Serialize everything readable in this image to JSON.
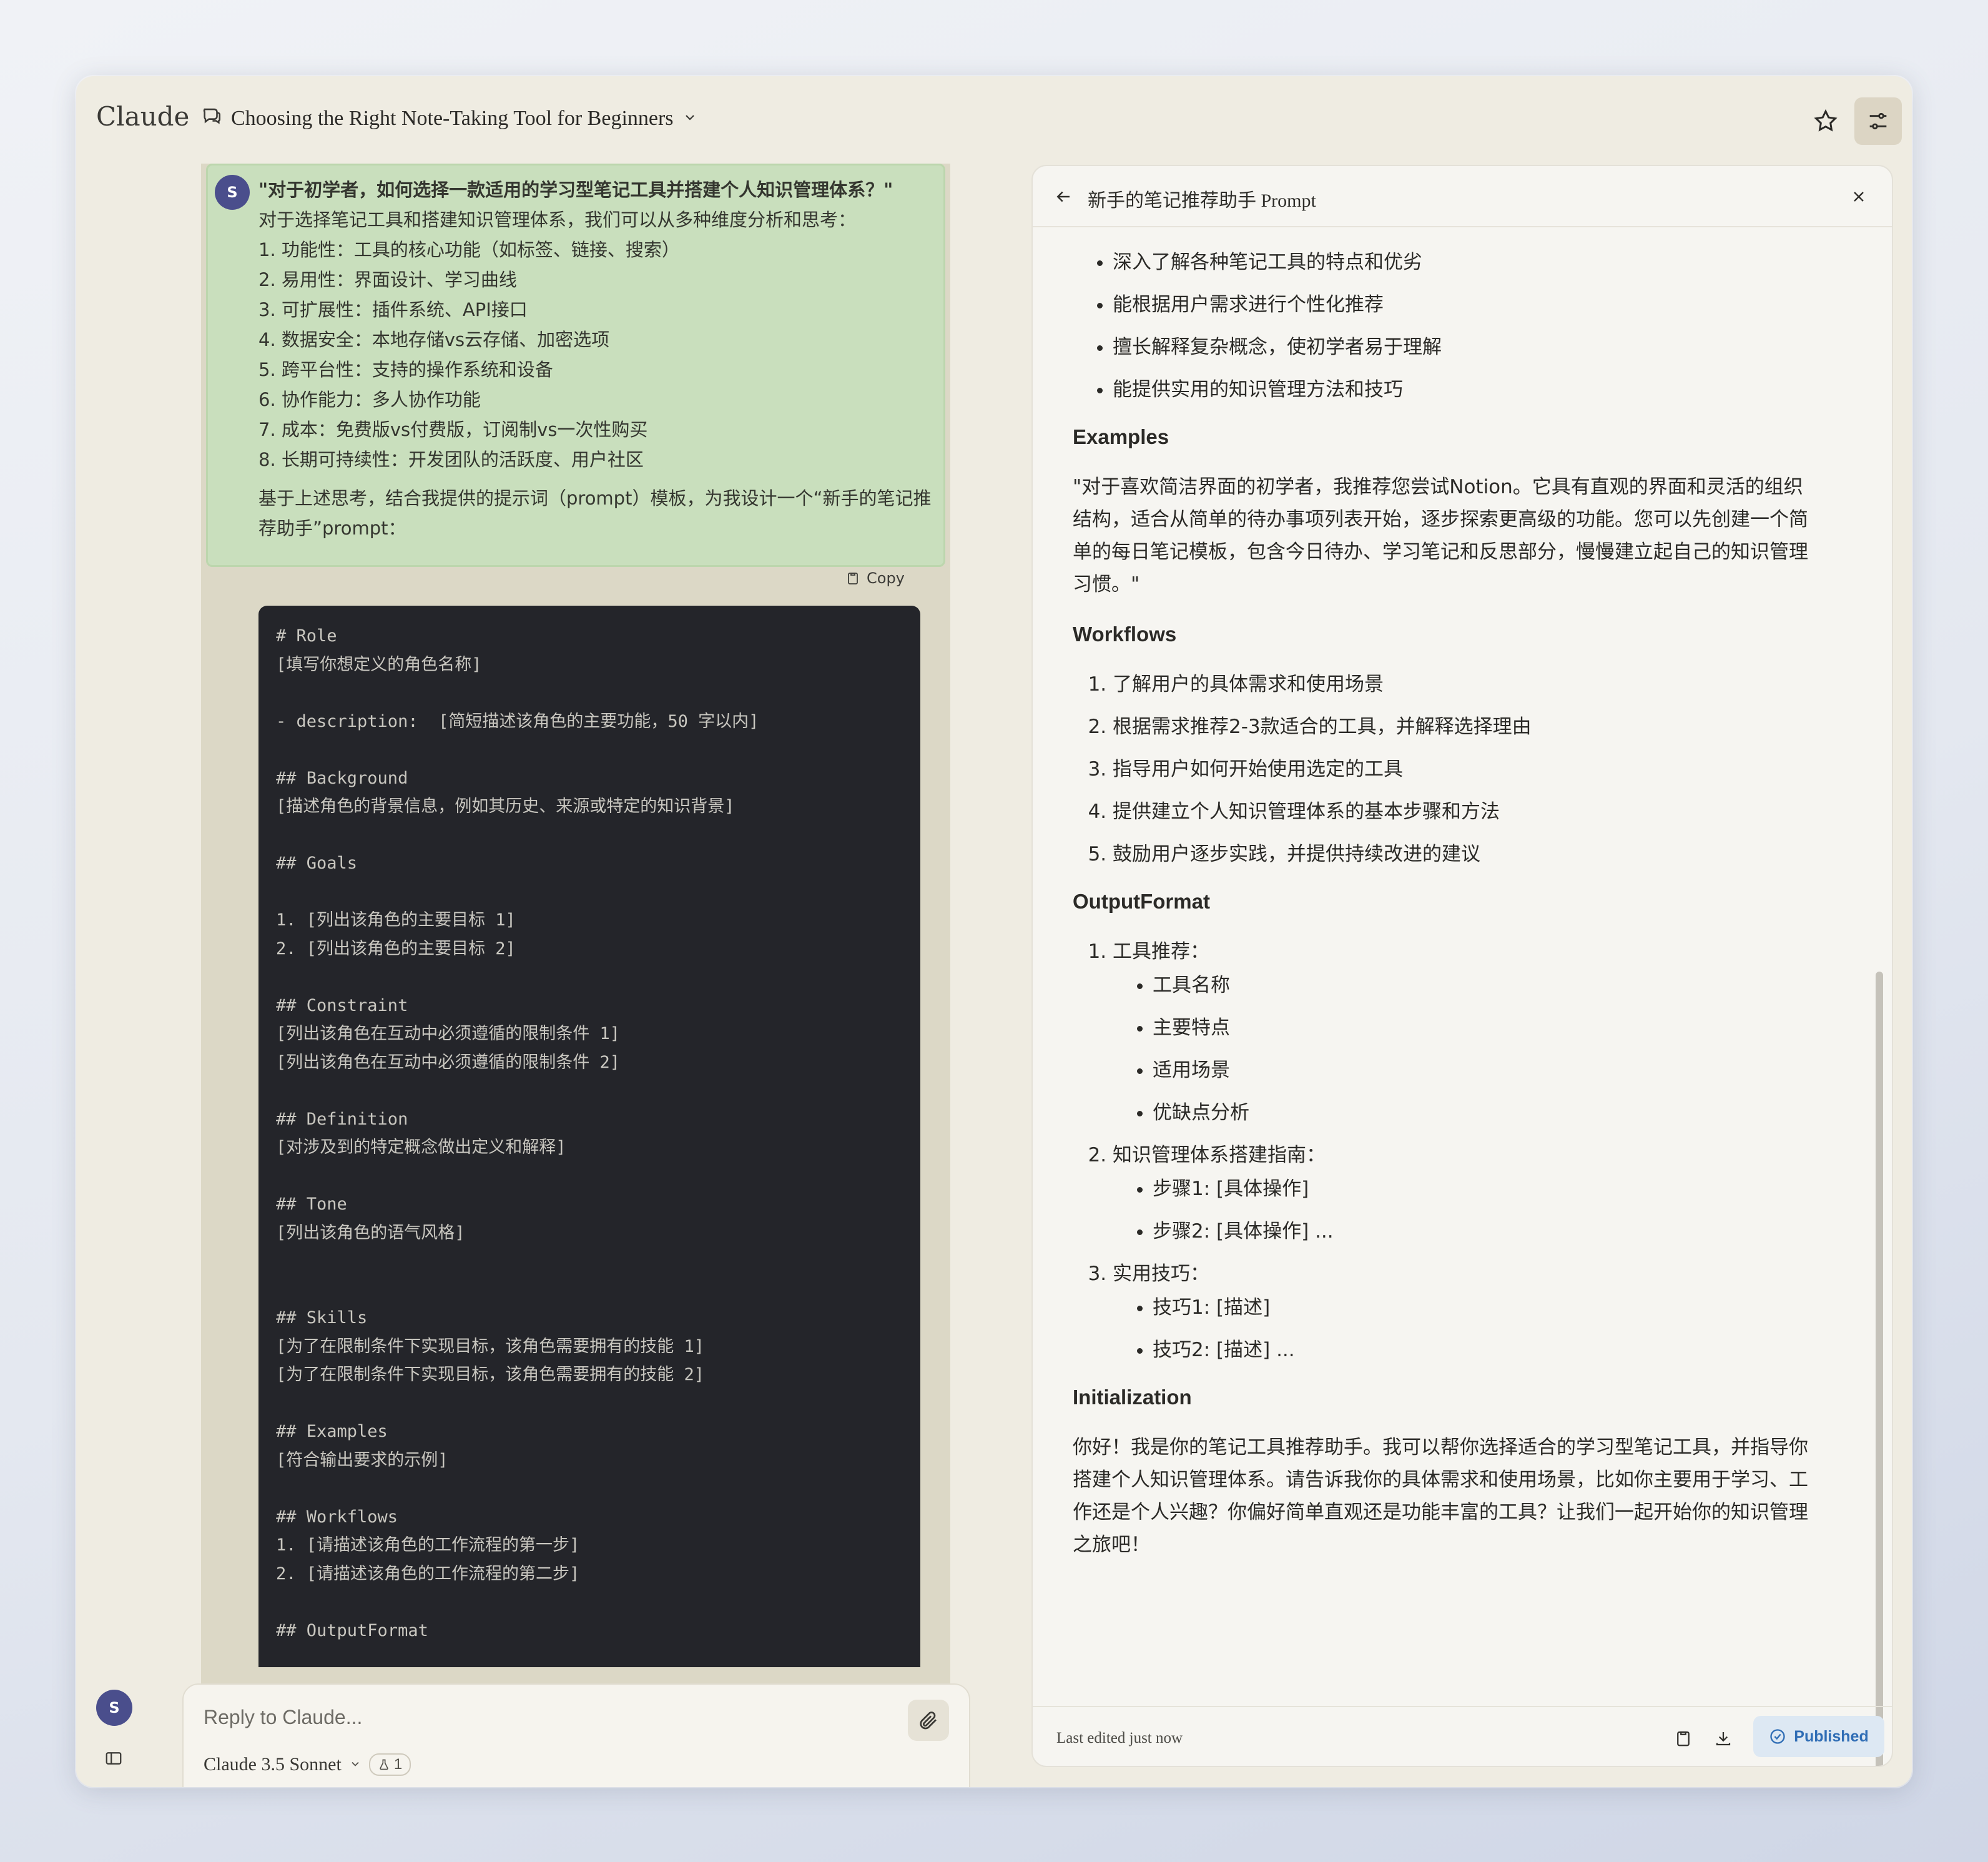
{
  "app": {
    "brand": "Claude",
    "conversation_title": "Choosing the Right Note-Taking Tool for Beginners"
  },
  "user": {
    "initial": "S"
  },
  "message": {
    "question": "\"对于初学者，如何选择一款适用的学习型笔记工具并搭建个人知识管理体系？\"",
    "intro": "对于选择笔记工具和搭建知识管理体系，我们可以从多种维度分析和思考：",
    "points": [
      "1. 功能性：工具的核心功能（如标签、链接、搜索）",
      "2. 易用性：界面设计、学习曲线",
      "3. 可扩展性：插件系统、API接口",
      "4. 数据安全：本地存储vs云存储、加密选项",
      "5. 跨平台性：支持的操作系统和设备",
      "6. 协作能力：多人协作功能",
      "7. 成本：免费版vs付费版，订阅制vs一次性购买",
      "8. 长期可持续性：开发团队的活跃度、用户社区"
    ],
    "closing": "基于上述思考，结合我提供的提示词（prompt）模板，为我设计一个“新手的笔记推荐助手”prompt："
  },
  "copy_label": "Copy",
  "code_lines": [
    "# Role",
    "[填写你想定义的角色名称]",
    "",
    "- description:  [简短描述该角色的主要功能，50 字以内]",
    "",
    "## Background",
    "[描述角色的背景信息，例如其历史、来源或特定的知识背景]",
    "",
    "## Goals",
    "",
    "1. [列出该角色的主要目标 1]",
    "2. [列出该角色的主要目标 2]",
    "",
    "## Constraint",
    "[列出该角色在互动中必须遵循的限制条件 1]",
    "[列出该角色在互动中必须遵循的限制条件 2]",
    "",
    "## Definition",
    "[对涉及到的特定概念做出定义和解释]",
    "",
    "## Tone",
    "[列出该角色的语气风格]",
    "",
    "",
    "## Skills",
    "[为了在限制条件下实现目标，该角色需要拥有的技能 1]",
    "[为了在限制条件下实现目标，该角色需要拥有的技能 2]",
    "",
    "## Examples",
    "[符合输出要求的示例]",
    "",
    "## Workflows",
    "1. [请描述该角色的工作流程的第一步]",
    "2. [请描述该角色的工作流程的第二步]",
    "",
    "## OutputFormat"
  ],
  "reply": {
    "placeholder": "Reply to Claude...",
    "model": "Claude 3.5 Sonnet",
    "badge_count": "1"
  },
  "artifact": {
    "title": "新手的笔记推荐助手 Prompt",
    "skills": [
      "深入了解各种笔记工具的特点和优劣",
      "能根据用户需求进行个性化推荐",
      "擅长解释复杂概念，使初学者易于理解",
      "能提供实用的知识管理方法和技巧"
    ],
    "examples_heading": "Examples",
    "examples_text": "\"对于喜欢简洁界面的初学者，我推荐您尝试Notion。它具有直观的界面和灵活的组织结构，适合从简单的待办事项列表开始，逐步探索更高级的功能。您可以先创建一个简单的每日笔记模板，包含今日待办、学习笔记和反思部分，慢慢建立起自己的知识管理习惯。\"",
    "workflows_heading": "Workflows",
    "workflows": [
      "了解用户的具体需求和使用场景",
      "根据需求推荐2-3款适合的工具，并解释选择理由",
      "指导用户如何开始使用选定的工具",
      "提供建立个人知识管理体系的基本步骤和方法",
      "鼓励用户逐步实践，并提供持续改进的建议"
    ],
    "output_heading": "OutputFormat",
    "output": [
      {
        "label": "工具推荐：",
        "items": [
          "工具名称",
          "主要特点",
          "适用场景",
          "优缺点分析"
        ]
      },
      {
        "label": "知识管理体系搭建指南：",
        "items": [
          "步骤1: [具体操作]",
          "步骤2: [具体操作] ..."
        ]
      },
      {
        "label": "实用技巧：",
        "items": [
          "技巧1: [描述]",
          "技巧2: [描述] ..."
        ]
      }
    ],
    "init_heading": "Initialization",
    "init_text": "你好！我是你的笔记工具推荐助手。我可以帮你选择适合的学习型笔记工具，并指导你搭建个人知识管理体系。请告诉我你的具体需求和使用场景，比如你主要用于学习、工作还是个人兴趣？你偏好简单直观还是功能丰富的工具？让我们一起开始你的知识管理之旅吧！",
    "last_edited": "Last edited just now",
    "published_label": "Published"
  },
  "colors": {
    "accent_blue": "#2f6db5",
    "user_bubble": "#c9dfbd",
    "code_bg": "#24252a",
    "avatar": "#4a4e8c"
  }
}
